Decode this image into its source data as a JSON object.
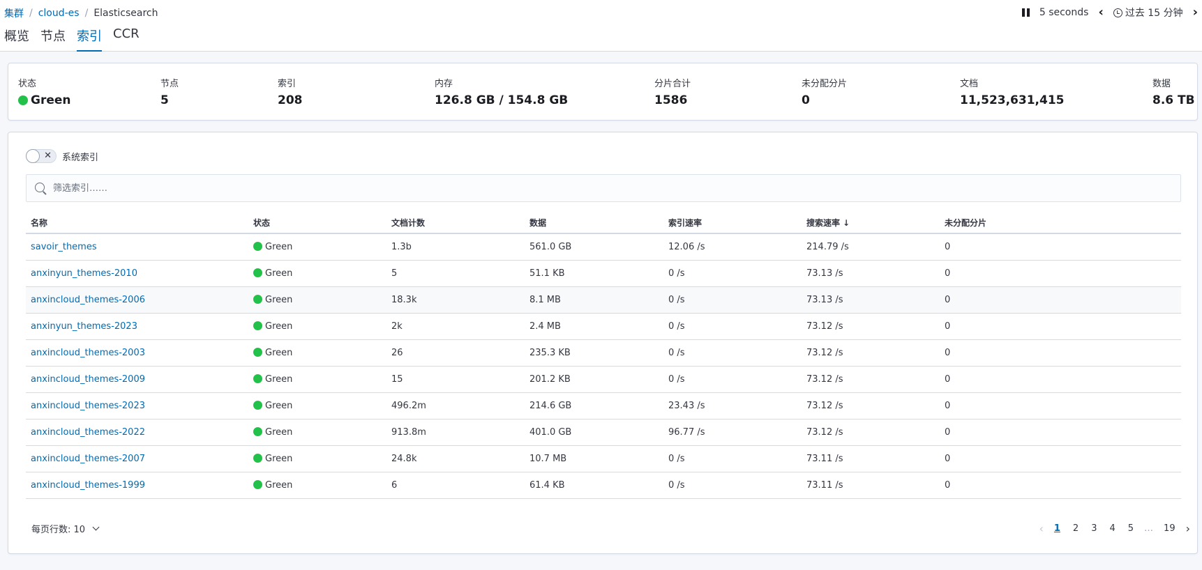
{
  "breadcrumbs": [
    {
      "label": "集群"
    },
    {
      "label": "cloud-es"
    },
    {
      "label": "Elasticsearch"
    }
  ],
  "time": {
    "interval": "5 seconds",
    "range": "过去 15 分钟"
  },
  "tabs": [
    "概览",
    "节点",
    "索引",
    "CCR"
  ],
  "summary": {
    "status_label": "状态",
    "status_value": "Green",
    "nodes_label": "节点",
    "nodes_value": "5",
    "indices_label": "索引",
    "indices_value": "208",
    "memory_label": "内存",
    "memory_value": "126.8 GB / 154.8 GB",
    "shards_label": "分片合计",
    "shards_value": "1586",
    "unassigned_label": "未分配分片",
    "unassigned_value": "0",
    "docs_label": "文档",
    "docs_value": "11,523,631,415",
    "data_label": "数据",
    "data_value": "8.6 TB"
  },
  "system_indices": {
    "label": "系统索引",
    "enabled": false
  },
  "search": {
    "placeholder": "筛选索引……"
  },
  "table": {
    "headers": [
      "名称",
      "状态",
      "文档计数",
      "数据",
      "索引速率",
      "搜索速率",
      "未分配分片"
    ],
    "rows": [
      {
        "name": "savoir_themes",
        "status": "Green",
        "docs": "1.3b",
        "data": "561.0 GB",
        "index_rate": "12.06 /s",
        "search_rate": "214.79 /s",
        "unassigned": "0"
      },
      {
        "name": "anxinyun_themes-2010",
        "status": "Green",
        "docs": "5",
        "data": "51.1 KB",
        "index_rate": "0 /s",
        "search_rate": "73.13 /s",
        "unassigned": "0"
      },
      {
        "name": "anxincloud_themes-2006",
        "status": "Green",
        "docs": "18.3k",
        "data": "8.1 MB",
        "index_rate": "0 /s",
        "search_rate": "73.13 /s",
        "unassigned": "0"
      },
      {
        "name": "anxinyun_themes-2023",
        "status": "Green",
        "docs": "2k",
        "data": "2.4 MB",
        "index_rate": "0 /s",
        "search_rate": "73.12 /s",
        "unassigned": "0"
      },
      {
        "name": "anxincloud_themes-2003",
        "status": "Green",
        "docs": "26",
        "data": "235.3 KB",
        "index_rate": "0 /s",
        "search_rate": "73.12 /s",
        "unassigned": "0"
      },
      {
        "name": "anxincloud_themes-2009",
        "status": "Green",
        "docs": "15",
        "data": "201.2 KB",
        "index_rate": "0 /s",
        "search_rate": "73.12 /s",
        "unassigned": "0"
      },
      {
        "name": "anxincloud_themes-2023",
        "status": "Green",
        "docs": "496.2m",
        "data": "214.6 GB",
        "index_rate": "23.43 /s",
        "search_rate": "73.12 /s",
        "unassigned": "0"
      },
      {
        "name": "anxincloud_themes-2022",
        "status": "Green",
        "docs": "913.8m",
        "data": "401.0 GB",
        "index_rate": "96.77 /s",
        "search_rate": "73.12 /s",
        "unassigned": "0"
      },
      {
        "name": "anxincloud_themes-2007",
        "status": "Green",
        "docs": "24.8k",
        "data": "10.7 MB",
        "index_rate": "0 /s",
        "search_rate": "73.11 /s",
        "unassigned": "0"
      },
      {
        "name": "anxincloud_themes-1999",
        "status": "Green",
        "docs": "6",
        "data": "61.4 KB",
        "index_rate": "0 /s",
        "search_rate": "73.11 /s",
        "unassigned": "0"
      }
    ]
  },
  "pagination": {
    "rows_per_page_label": "每页行数: 10",
    "pages": [
      "1",
      "2",
      "3",
      "4",
      "5",
      "…",
      "19"
    ],
    "current": "1"
  },
  "colors": {
    "accent": "#006bb4",
    "status_green": "#24c14a",
    "loading_bar": "#d6336c"
  }
}
